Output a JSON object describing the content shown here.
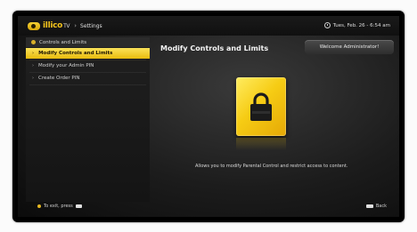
{
  "header": {
    "brand": "illico",
    "brand_suffix": "TV",
    "breadcrumb_sep": "›",
    "breadcrumb": "Settings",
    "datetime": "Tues, Feb. 26 - 6:54 am"
  },
  "sidebar": {
    "section_title": "Controls and Limits",
    "items": [
      {
        "label": "Modify Controls and Limits",
        "selected": true
      },
      {
        "label": "Modify your Admin PIN",
        "selected": false
      },
      {
        "label": "Create Order PIN",
        "selected": false
      }
    ]
  },
  "main": {
    "title": "Modify Controls and Limits",
    "welcome": "Welcome Administrator!",
    "description": "Allows you to modify Parental Control and restrict access to content."
  },
  "footer": {
    "exit_hint": "To exit, press",
    "back_label": "Back"
  },
  "colors": {
    "accent": "#f2c21c",
    "selected_bg": "#f2cd2a",
    "background": "#1a1a1a"
  },
  "icons": {
    "tile": "padlock-icon",
    "clock": "clock-icon",
    "logo": "illico-logo-icon"
  }
}
